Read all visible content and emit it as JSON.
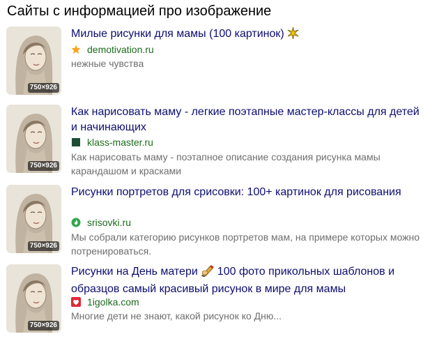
{
  "section": {
    "title": "Сайты с информацией про изображение"
  },
  "results": [
    {
      "thumb_size": "750×926",
      "title": "Милые рисунки для мамы (100 картинок)",
      "title_emoji": "sparkle-icon",
      "domain": "demotivation.ru",
      "favicon": "star-icon",
      "snippet": "нежные чувства"
    },
    {
      "thumb_size": "750×926",
      "title": "Как нарисовать маму - легкие поэтапные мастер-классы для детей и начинающих",
      "domain": "klass-master.ru",
      "favicon": "green-square-icon",
      "snippet": "Как нарисовать маму - поэтапное описание создания рисунка мамы карандашом и красками"
    },
    {
      "thumb_size": "750×926",
      "title": "Рисунки портретов для срисовки: 100+ картинок для рисования",
      "domain": "srisovki.ru",
      "favicon": "green-circle-flame-icon",
      "snippet": "Мы собрали категорию рисунков портретов мам, на примере которых можно потренироваться."
    },
    {
      "thumb_size": "750×926",
      "title_part1": "Рисунки на День матери",
      "title_emoji": "writing-hand-icon",
      "title_part2": "100 фото прикольных шаблонов и образцов самый красивый рисунок в мире для мамы",
      "domain": "1igolka.com",
      "favicon": "red-heart-icon",
      "snippet": "Многие дети не знают, какой рисунок ко Дню..."
    }
  ],
  "colors": {
    "title_link": "#0d0d72",
    "domain": "#1d6a1d",
    "snippet": "#6e6e6e",
    "star": "#f5a623",
    "klass_fav": "#1e4d36",
    "srisovki_fav": "#2fa84f",
    "igolka_fav": "#e32636"
  }
}
